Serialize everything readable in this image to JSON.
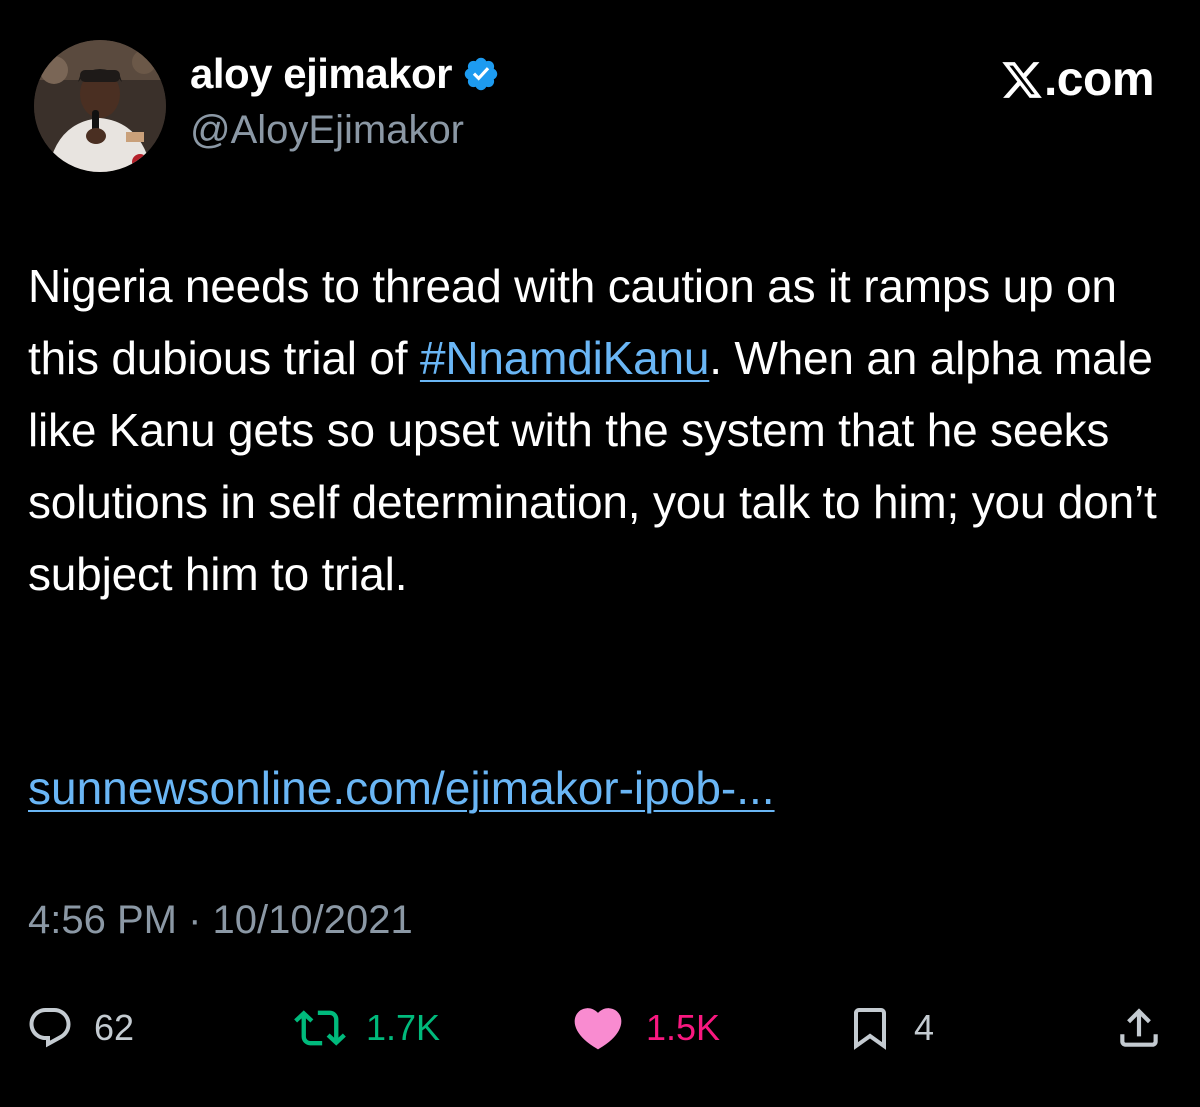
{
  "author": {
    "display_name": "aloy ejimakor",
    "handle": "@AloyEjimakor",
    "verified": true,
    "verified_color": "#1d9bf0",
    "avatar_icon": "profile-photo"
  },
  "brand": {
    "label": ".com",
    "icon": "x-logo-icon"
  },
  "tweet": {
    "text_before": "Nigeria needs to thread with caution as it ramps up on this dubious trial of ",
    "hashtag": "#NnamdiKanu",
    "text_after": ". When an alpha male like Kanu gets so upset with the system that he seeks solutions in self determination, you talk to him; you don’t subject him to trial.",
    "link": "sunnewsonline.com/ejimakor-ipob-..."
  },
  "meta": {
    "time": "4:56 PM",
    "separator": " · ",
    "date": "10/10/2021"
  },
  "actions": {
    "replies": "62",
    "retweets": "1.7K",
    "likes": "1.5K",
    "bookmarks": "4"
  },
  "colors": {
    "background": "#000000",
    "link": "#6ab6f5",
    "secondary_text": "#8b98a5",
    "retweet": "#00ba7c",
    "like": "#f91880"
  }
}
